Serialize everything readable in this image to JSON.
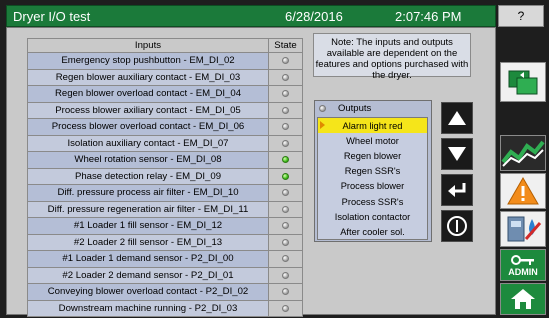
{
  "title_bar": {
    "title": "Dryer I/O test",
    "date": "6/28/2016",
    "time": "2:07:46 PM",
    "help_label": "?"
  },
  "inputs_table": {
    "col_inputs": "Inputs",
    "col_state": "State",
    "rows": [
      {
        "label": "Emergency stop pushbutton - EM_DI_02",
        "on": false
      },
      {
        "label": "Regen blower auxiliary contact - EM_DI_03",
        "on": false
      },
      {
        "label": "Regen blower overload contact - EM_DI_04",
        "on": false
      },
      {
        "label": "Process blower axiliary contact - EM_DI_05",
        "on": false
      },
      {
        "label": "Process blower overload contact - EM_DI_06",
        "on": false
      },
      {
        "label": "Isolation auxiliary contact - EM_DI_07",
        "on": false
      },
      {
        "label": "Wheel rotation sensor - EM_DI_08",
        "on": true
      },
      {
        "label": "Phase detection relay - EM_DI_09",
        "on": true
      },
      {
        "label": "Diff. pressure process air filter - EM_DI_10",
        "on": false
      },
      {
        "label": "Diff. pressure regeneration air filter - EM_DI_11",
        "on": false
      },
      {
        "label": "#1 Loader 1 fill sensor - EM_DI_12",
        "on": false
      },
      {
        "label": "#2 Loader 2 fill sensor - EM_DI_13",
        "on": false
      },
      {
        "label": "#1 Loader 1 demand sensor - P2_DI_00",
        "on": false
      },
      {
        "label": "#2 Loader 2 demand sensor - P2_DI_01",
        "on": false
      },
      {
        "label": "Conveying blower overload contact - P2_DI_02",
        "on": false
      },
      {
        "label": "Downstream machine running - P2_DI_03",
        "on": false
      }
    ]
  },
  "note": "Note: The inputs and outputs available are dependent on the features and options purchased with the dryer.",
  "outputs": {
    "header": "Outputs",
    "selected_index": 0,
    "items": [
      "Alarm light red",
      "Wheel motor",
      "Regen blower",
      "Regen SSR's",
      "Process blower",
      "Process SSR's",
      "Isolation contactor",
      "After cooler sol."
    ]
  },
  "sidebar": {
    "admin_label": "ADMIN"
  },
  "colors": {
    "title_green": "#1b7a3a",
    "selected_yellow": "#f5e51a",
    "led_on": "#3fbf1a"
  }
}
